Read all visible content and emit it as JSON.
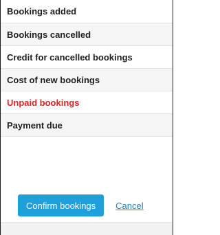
{
  "summary": {
    "rows": [
      {
        "label": "Bookings added"
      },
      {
        "label": "Bookings cancelled"
      },
      {
        "label": "Credit for cancelled bookings"
      },
      {
        "label": "Cost of new bookings"
      },
      {
        "label": "Unpaid bookings",
        "color": "#e02424"
      },
      {
        "label": "Payment due"
      }
    ]
  },
  "actions": {
    "confirm_label": "Confirm bookings",
    "cancel_label": "Cancel"
  },
  "colors": {
    "primary_button": "#1fa0dc",
    "link": "#1c7fc0",
    "warning_text": "#e02424"
  }
}
